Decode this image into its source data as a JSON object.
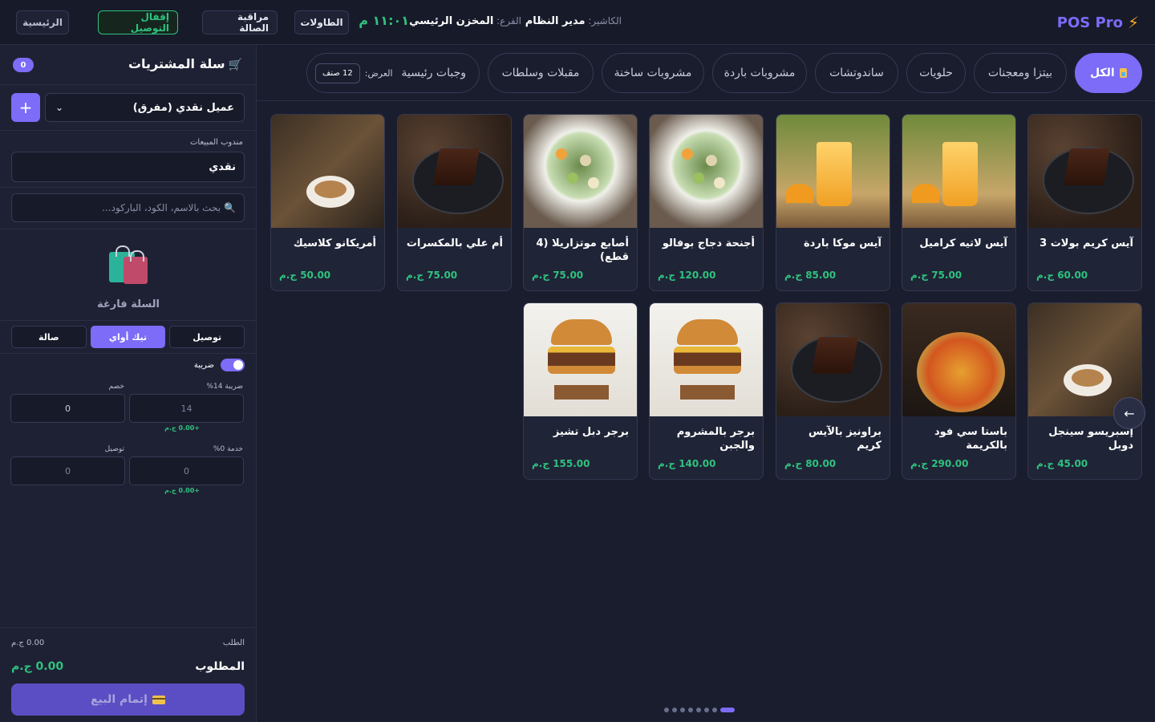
{
  "header": {
    "brand": "POS Pro",
    "cashier_label": "الكاشير:",
    "cashier_name": "مدير النظام",
    "branch_label": "الفرع:",
    "branch_name": "المخزن الرئيسي",
    "clock": "١١:٠١ م",
    "buttons": {
      "tables": "الطاولات",
      "hall": "مراقبة الصالة",
      "delivery": "إقفال التوصيل",
      "home": "الرئيسية"
    }
  },
  "categories": [
    {
      "label": "الكل",
      "active": true
    },
    {
      "label": "بيتزا ومعجنات"
    },
    {
      "label": "حلويات"
    },
    {
      "label": "ساندوتشات"
    },
    {
      "label": "مشروبات باردة"
    },
    {
      "label": "مشروبات ساخنة"
    },
    {
      "label": "مقبلات وسلطات"
    },
    {
      "label": "وجبات رئيسية"
    }
  ],
  "view": {
    "label": "العرض:",
    "count": "12 صنف"
  },
  "products": [
    {
      "name": "آيس كريم بولات 3",
      "price": "60.00 ج.م",
      "img": "cake"
    },
    {
      "name": "آيس لاتيه كراميل",
      "price": "75.00 ج.م",
      "img": "juice"
    },
    {
      "name": "آيس موكا باردة",
      "price": "85.00 ج.م",
      "img": "juice"
    },
    {
      "name": "أجنحة دجاج بوفالو",
      "price": "120.00 ج.م",
      "img": "salad"
    },
    {
      "name": "أصابع موتزاريلا (4 قطع)",
      "price": "75.00 ج.م",
      "img": "salad"
    },
    {
      "name": "أم علي بالمكسرات",
      "price": "75.00 ج.م",
      "img": "cake"
    },
    {
      "name": "أمريكانو كلاسيك",
      "price": "50.00 ج.م",
      "img": "coffee"
    },
    {
      "name": "إسبريسو سينجل دوبل",
      "price": "45.00 ج.م",
      "img": "coffee"
    },
    {
      "name": "باستا سي فود بالكريمة",
      "price": "290.00 ج.م",
      "img": "pizza"
    },
    {
      "name": "براونيز بالآيس كريم",
      "price": "80.00 ج.م",
      "img": "cake"
    },
    {
      "name": "برجر بالمشروم والجبن",
      "price": "140.00 ج.م",
      "img": "burger"
    },
    {
      "name": "برجر دبل تشيز",
      "price": "155.00 ج.م",
      "img": "burger"
    }
  ],
  "pager": {
    "pages": 8,
    "current": 1
  },
  "cart": {
    "title": "سلة المشتريات",
    "count": "0",
    "customer": "عميل نقدي (مفرق)",
    "plus": "+",
    "salesrep_label": "مندوب المبيعات",
    "salesrep_value": "نقدي",
    "search_placeholder": "بحث بالاسم، الكود، الباركود...",
    "empty_text": "السلة فارغة",
    "order_types": [
      "صالة",
      "تيك أواي",
      "توصيل"
    ],
    "active_order_type": 1,
    "tax_toggle_label": "ضريبة",
    "tax_label": "ضريبة 14%",
    "tax_value": "14",
    "tax_amount": "+0.00 ج.م",
    "discount_label": "خصم",
    "discount_value": "0",
    "service_label": "خدمة 0%",
    "service_value": "0",
    "service_amount": "+0.00 ج.م",
    "delivery_label": "توصيل",
    "delivery_value": "0",
    "subtotal_label": "الطلب",
    "subtotal_value": "0.00 ج.م",
    "total_label": "المطلوب",
    "total_value": "0.00 ج.م",
    "pay_label": "إتمام البيع"
  },
  "colors": {
    "accent": "#7c6cf7",
    "price": "#2ec27e",
    "background": "#1a1d2e"
  }
}
